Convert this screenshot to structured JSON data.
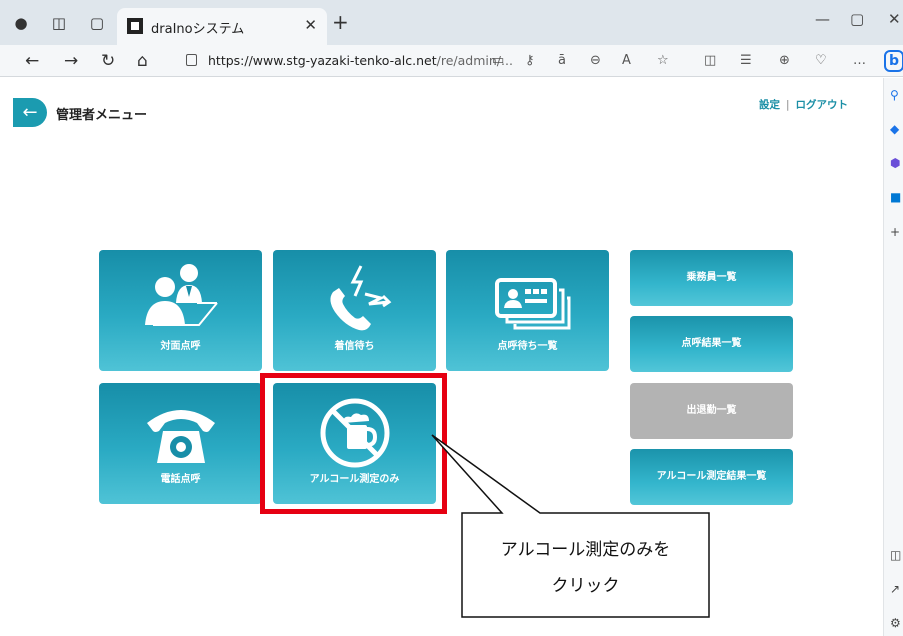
{
  "browser": {
    "tab_title": "draInoシステム",
    "url_host": "https://www.stg-yazaki-tenko-alc.net",
    "url_path": "/re/admin/..."
  },
  "header": {
    "title": "管理者メニュー",
    "settings_link": "設定",
    "logout_link": "ログアウト"
  },
  "tiles": {
    "face_to_face": "対面点呼",
    "waiting_call": "着信待ち",
    "roll_call_wait_list": "点呼待ち一覧",
    "phone_roll_call": "電話点呼",
    "alcohol_only": "アルコール測定のみ"
  },
  "buttons": {
    "crew_list": "乗務員一覧",
    "roll_call_results": "点呼結果一覧",
    "attendance_list": "出退勤一覧",
    "alcohol_results": "アルコール測定結果一覧"
  },
  "callout": {
    "line1": "アルコール測定のみを",
    "line2": "クリック"
  },
  "colors": {
    "tile": "#2aaac3",
    "highlight": "#e60012",
    "disabled": "#b3b3b3"
  }
}
